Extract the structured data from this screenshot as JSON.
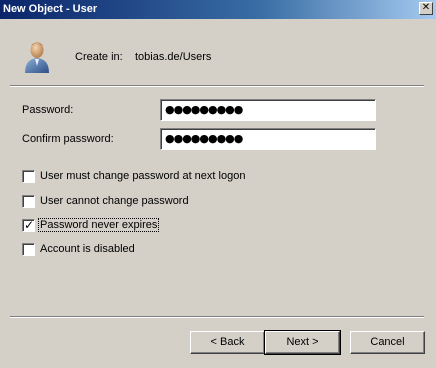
{
  "window": {
    "title": "New Object - User",
    "close_glyph": "✕"
  },
  "header": {
    "icon": "user-icon",
    "create_in_label": "Create in:",
    "create_in_path": "tobias.de/Users"
  },
  "form": {
    "password_label": "Password:",
    "password_value": "●●●●●●●●●",
    "confirm_label": "Confirm password:",
    "confirm_value": "●●●●●●●●●"
  },
  "options": [
    {
      "label": "User must change password at next logon",
      "checked": false
    },
    {
      "label": "User cannot change password",
      "checked": false
    },
    {
      "label": "Password never expires",
      "checked": true
    },
    {
      "label": "Account is disabled",
      "checked": false
    }
  ],
  "check_glyph": "✓",
  "buttons": {
    "back": "< Back",
    "next": "Next >",
    "cancel": "Cancel"
  }
}
